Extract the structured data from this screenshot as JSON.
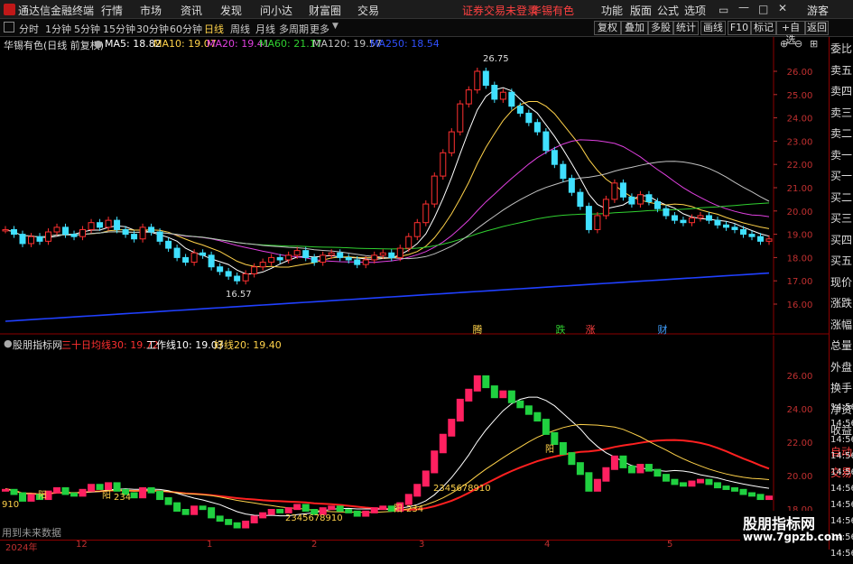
{
  "app": {
    "title": "通达信金融终端",
    "menus": [
      "行情",
      "市场",
      "资讯",
      "发现",
      "问小达",
      "财富圈",
      "交易"
    ],
    "notice": "证券交易未登录",
    "stock_name": "华锡有色",
    "right_menus": [
      "功能",
      "版面",
      "公式",
      "选项"
    ],
    "guest": "游客"
  },
  "periods": [
    "分时",
    "1分钟",
    "5分钟",
    "15分钟",
    "30分钟",
    "60分钟",
    "日线",
    "周线",
    "月线",
    "多周期",
    "更多"
  ],
  "active_period": "日线",
  "toolbar": [
    "复权",
    "叠加",
    "多股",
    "统计",
    "画线",
    "F10",
    "标记",
    "+自选",
    "返回"
  ],
  "main": {
    "title": "华锡有色(日线 前复权)",
    "ma": [
      {
        "label": "MA5: 18.82",
        "color": "#ffffff"
      },
      {
        "label": "MA10: 19.07",
        "color": "#ffd24a"
      },
      {
        "label": "MA20: 19.41",
        "color": "#e040e0"
      },
      {
        "label": "MA60: 21.17",
        "color": "#30d030"
      },
      {
        "label": "MA120: 19.57",
        "color": "#c0c0c0"
      },
      {
        "label": "MA250: 18.54",
        "color": "#3050ff"
      }
    ],
    "high": "26.75",
    "low": "16.57",
    "yaxis": [
      "26.00",
      "25.00",
      "24.00",
      "23.00",
      "22.00",
      "21.00",
      "20.00",
      "19.00",
      "18.00",
      "17.00",
      "16.00"
    ],
    "markers": [
      {
        "t": "腾",
        "c": "#ffd24a"
      },
      {
        "t": "跌",
        "c": "#30d030"
      },
      {
        "t": "涨",
        "c": "#ff4040"
      },
      {
        "t": "财",
        "c": "#40a0ff"
      }
    ]
  },
  "sub": {
    "title": "股朋指标网",
    "lines": [
      {
        "label": "三十日均线30: 19.72",
        "color": "#ff3030"
      },
      {
        "label": "工作线10: 19.03",
        "color": "#ffffff"
      },
      {
        "label": "好线20: 19.40",
        "color": "#ffd24a"
      }
    ],
    "yaxis": [
      "26.00",
      "24.00",
      "22.00",
      "20.00",
      "18.00"
    ],
    "notes": [
      "910",
      "阳",
      "234",
      "阳",
      "2345678910",
      "阳",
      "234",
      "2345678910",
      "阳"
    ],
    "future": "用到未来数据"
  },
  "xaxis": [
    "2024年",
    "12",
    "1",
    "2",
    "3",
    "4",
    "5"
  ],
  "side": [
    "委比",
    "卖五",
    "卖四",
    "卖三",
    "卖二",
    "卖一",
    "买一",
    "买二",
    "买三",
    "买四",
    "买五",
    "现价",
    "涨跌",
    "涨幅",
    "总量",
    "外盘",
    "换手",
    "净资",
    "收益",
    "自动",
    "交易"
  ],
  "side_right": [
    "14:56",
    "14:56",
    "14:56",
    "14:56",
    "14:56",
    "14:56",
    "14:56",
    "14:56",
    "14:56",
    "14:56"
  ],
  "watermark": {
    "name": "股朋指标网",
    "url": "www.7gpzb.com"
  },
  "chart_data": {
    "type": "candlestick",
    "series": [
      {
        "name": "price",
        "values": [
          19.2,
          19.0,
          18.6,
          18.9,
          18.7,
          19.1,
          19.3,
          19.0,
          18.9,
          19.2,
          19.5,
          19.3,
          19.6,
          19.2,
          19.0,
          18.8,
          19.3,
          19.1,
          18.7,
          18.4,
          18.0,
          17.8,
          18.2,
          18.1,
          17.6,
          17.4,
          17.2,
          17.0,
          17.3,
          17.6,
          17.8,
          18.0,
          17.9,
          18.1,
          18.3,
          18.0,
          17.8,
          18.1,
          18.2,
          18.0,
          17.9,
          17.7,
          17.9,
          18.1,
          18.2,
          18.0,
          18.4,
          18.9,
          19.5,
          20.3,
          21.5,
          22.5,
          23.4,
          24.6,
          25.2,
          26.0,
          25.4,
          24.8,
          25.1,
          24.5,
          24.2,
          23.8,
          23.4,
          22.6,
          22.0,
          21.4,
          20.8,
          20.2,
          19.2,
          19.8,
          20.5,
          21.2,
          20.6,
          20.3,
          20.7,
          20.4,
          20.1,
          19.8,
          19.6,
          19.5,
          19.7,
          19.8,
          19.6,
          19.4,
          19.3,
          19.2,
          19.0,
          18.9,
          18.7,
          18.8
        ]
      }
    ]
  }
}
